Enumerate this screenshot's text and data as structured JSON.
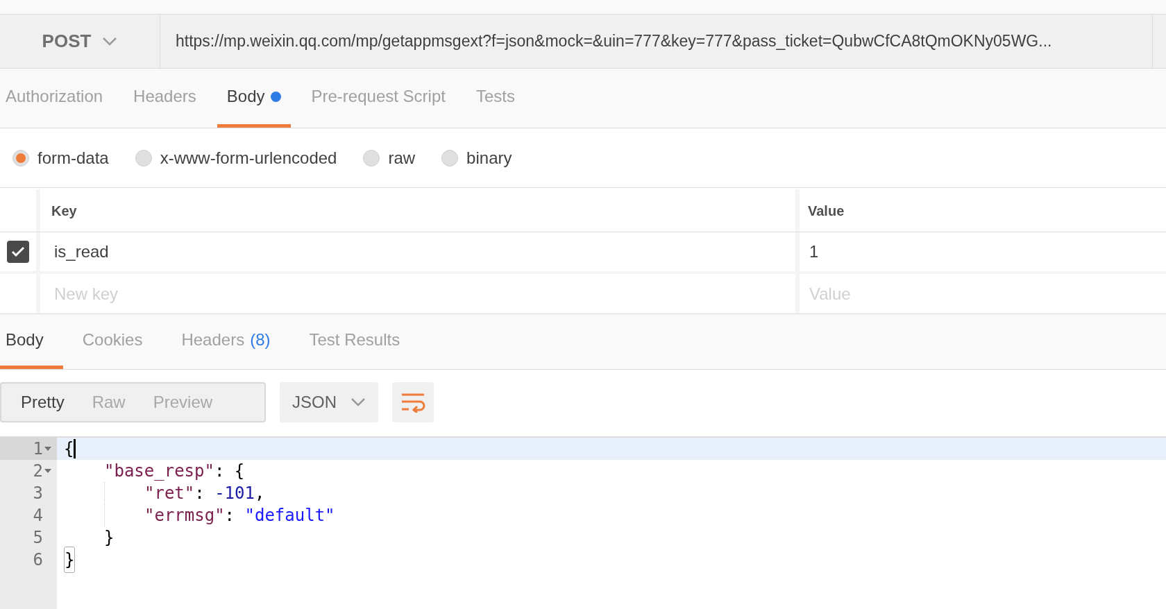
{
  "request": {
    "method": "POST",
    "url": "https://mp.weixin.qq.com/mp/getappmsgext?f=json&mock=&uin=777&key=777&pass_ticket=QubwCfCA8tQmOKNy05WG..."
  },
  "request_tabs": [
    {
      "label": "Authorization",
      "selected": false,
      "dot": false
    },
    {
      "label": "Headers",
      "selected": false,
      "dot": false
    },
    {
      "label": "Body",
      "selected": true,
      "dot": true
    },
    {
      "label": "Pre-request Script",
      "selected": false,
      "dot": false
    },
    {
      "label": "Tests",
      "selected": false,
      "dot": false
    }
  ],
  "body_types": [
    {
      "label": "form-data",
      "selected": true
    },
    {
      "label": "x-www-form-urlencoded",
      "selected": false
    },
    {
      "label": "raw",
      "selected": false
    },
    {
      "label": "binary",
      "selected": false
    }
  ],
  "params_table": {
    "columns": [
      "Key",
      "Value"
    ],
    "rows": [
      {
        "checked": true,
        "key": "is_read",
        "value": "1"
      }
    ],
    "new_row": {
      "key_placeholder": "New key",
      "value_placeholder": "Value"
    }
  },
  "response_tabs": [
    {
      "label": "Body",
      "selected": true
    },
    {
      "label": "Cookies",
      "selected": false
    },
    {
      "label": "Headers",
      "count": "(8)",
      "selected": false
    },
    {
      "label": "Test Results",
      "selected": false
    }
  ],
  "view_modes": [
    {
      "label": "Pretty",
      "selected": true
    },
    {
      "label": "Raw",
      "selected": false
    },
    {
      "label": "Preview",
      "selected": false
    }
  ],
  "format": "JSON",
  "wrap_on": true,
  "code_lines": [
    {
      "number": "1",
      "foldable": true,
      "active": true,
      "tokens": [
        {
          "text": "{",
          "kind": "open",
          "matched": false
        }
      ]
    },
    {
      "number": "2",
      "foldable": true,
      "active": false,
      "tokens": [
        {
          "text": "\"base_resp\"",
          "kind": "key"
        },
        {
          "text": ": ",
          "kind": "punct"
        },
        {
          "text": "{",
          "kind": "open"
        }
      ]
    },
    {
      "number": "3",
      "foldable": false,
      "active": false,
      "tokens": [
        {
          "text": "\"ret\"",
          "kind": "key"
        },
        {
          "text": ": ",
          "kind": "punct"
        },
        {
          "text": "-101",
          "kind": "number"
        },
        {
          "text": ",",
          "kind": "punct"
        }
      ]
    },
    {
      "number": "4",
      "foldable": false,
      "active": false,
      "tokens": [
        {
          "text": "\"errmsg\"",
          "kind": "key"
        },
        {
          "text": ": ",
          "kind": "punct"
        },
        {
          "text": "\"default\"",
          "kind": "string"
        }
      ]
    },
    {
      "number": "5",
      "foldable": false,
      "active": false,
      "tokens": [
        {
          "text": "}",
          "kind": "close"
        }
      ]
    },
    {
      "number": "6",
      "foldable": false,
      "active": false,
      "tokens": [
        {
          "text": "}",
          "kind": "close",
          "matched": true
        }
      ]
    }
  ]
}
